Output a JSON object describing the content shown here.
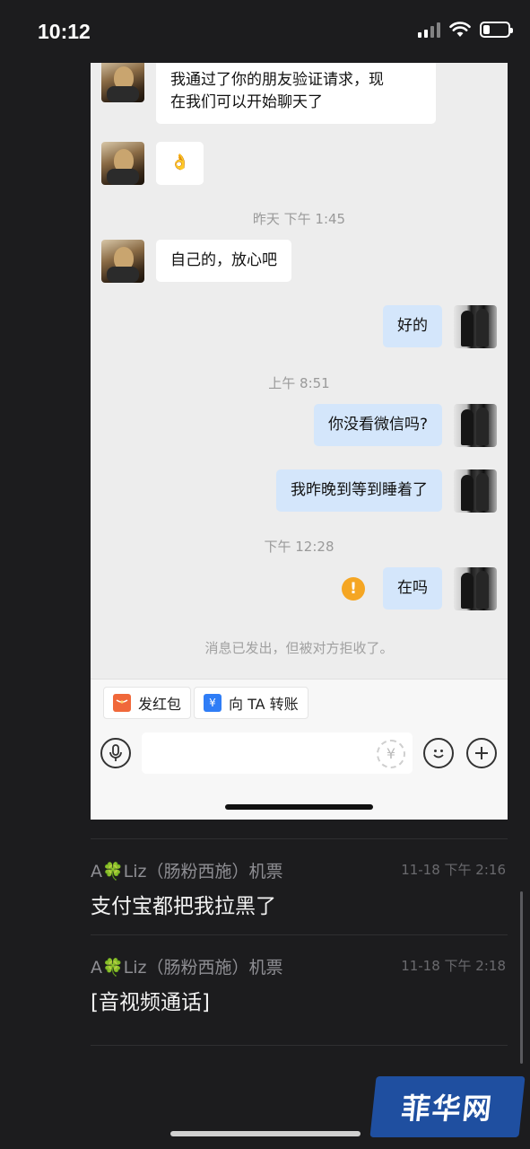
{
  "status_bar": {
    "time": "10:12",
    "battery_level": 0.25
  },
  "chat": {
    "messages": [
      {
        "text": "我通过了你的朋友验证请求，现\n在我们可以开始聊天了"
      },
      {
        "text": "👌"
      },
      {
        "time_label": "昨天 下午 1:45"
      },
      {
        "text": "自己的，放心吧"
      },
      {
        "text": "好的"
      },
      {
        "time_label": "上午 8:51"
      },
      {
        "text": "你没看微信吗?"
      },
      {
        "text": "我昨晚到等到睡着了"
      },
      {
        "time_label": "下午 12:28"
      },
      {
        "text": "在吗"
      }
    ],
    "warning_glyph": "!",
    "system_note": "消息已发出，但被对方拒收了。",
    "quick_actions": [
      {
        "label": "发红包",
        "icon": "red-packet-icon",
        "color": "#f0683a"
      },
      {
        "label": "向 TA 转账",
        "icon": "transfer-icon",
        "color": "#2f7df6",
        "glyph": "¥"
      }
    ]
  },
  "comments": [
    {
      "name": "A🍀Liz（肠粉西施）机票",
      "time": "11-18 下午 2:16",
      "text": "支付宝都把我拉黑了"
    },
    {
      "name": "A🍀Liz（肠粉西施）机票",
      "time": "11-18 下午 2:18",
      "text": "[音视频通话]"
    }
  ],
  "watermark": "菲华网",
  "colors": {
    "background": "#1c1c1e",
    "outgoing_bubble": "#d4e6fb",
    "warning": "#f5a623",
    "watermark": "#1f4fa0"
  }
}
